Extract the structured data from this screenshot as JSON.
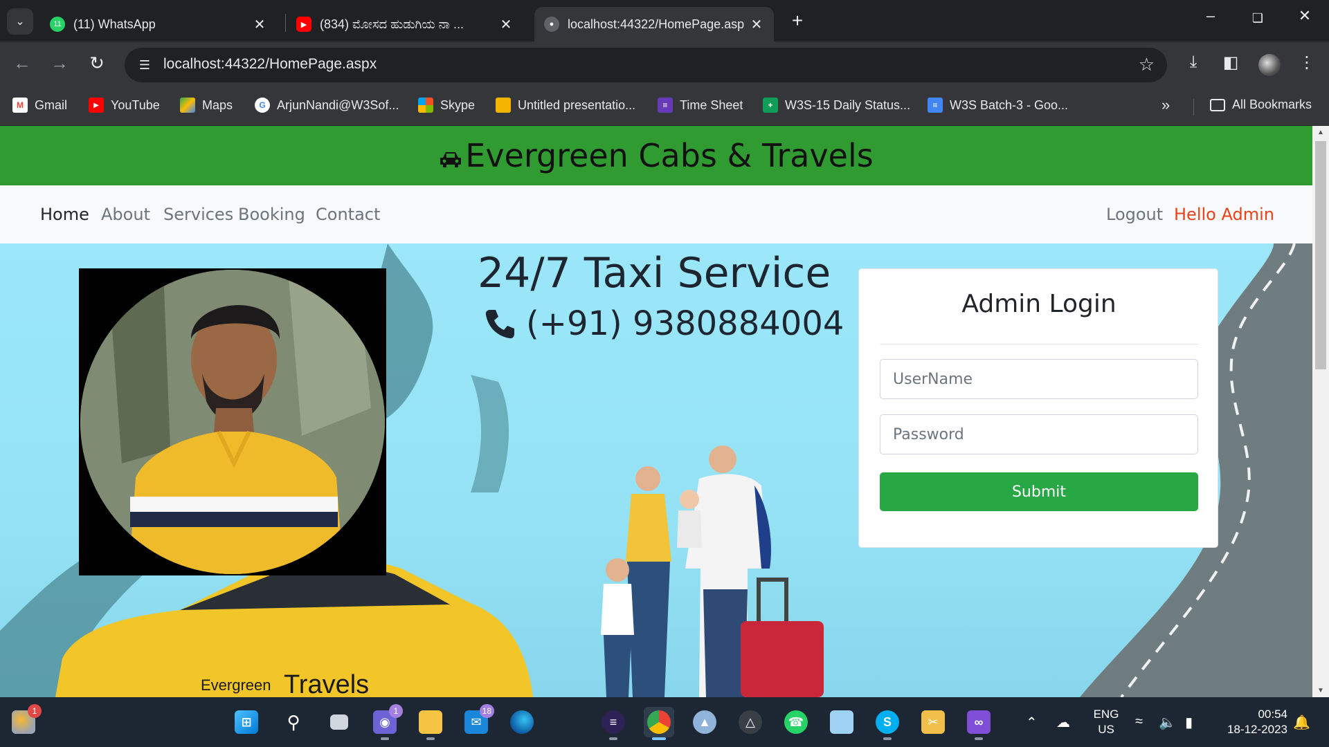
{
  "browser": {
    "tabs": [
      {
        "title": "(11) WhatsApp",
        "favicon": "whatsapp-icon",
        "badge": "11",
        "color": "#25d366"
      },
      {
        "title": "(834) ಮೋಸದ ಹುಡುಗಿಯ ನಾ ...",
        "favicon": "youtube-icon",
        "color": "#ff0000"
      },
      {
        "title": "localhost:44322/HomePage.asp",
        "favicon": "globe-icon",
        "active": true
      }
    ],
    "url": "localhost:44322/HomePage.aspx",
    "bookmarks": [
      {
        "label": "Gmail",
        "icon": "gmail-icon"
      },
      {
        "label": "YouTube",
        "icon": "youtube-icon"
      },
      {
        "label": "Maps",
        "icon": "maps-icon"
      },
      {
        "label": "ArjunNandi@W3Sof...",
        "icon": "google-icon"
      },
      {
        "label": "Skype",
        "icon": "microsoft-icon"
      },
      {
        "label": "Untitled presentatio...",
        "icon": "slides-icon"
      },
      {
        "label": "Time Sheet",
        "icon": "forms-icon"
      },
      {
        "label": "W3S-15 Daily Status...",
        "icon": "sheets-icon"
      },
      {
        "label": "W3S Batch-3 - Goo...",
        "icon": "docs-icon"
      }
    ],
    "bookmarks_overflow": "»",
    "all_bookmarks": "All Bookmarks"
  },
  "site": {
    "brand": "Evergreen Cabs & Travels",
    "nav": {
      "home": "Home",
      "about": "About",
      "services": "Services",
      "booking": "Booking",
      "contact": "Contact",
      "logout": "Logout",
      "hello": "Hello Admin"
    },
    "headline": "24/7 Taxi Service",
    "phone": "(+91) 9380884004",
    "taxi_text_small": "Evergreen",
    "taxi_text_large": "Travels",
    "login": {
      "title": "Admin Login",
      "username_placeholder": "UserName",
      "password_placeholder": "Password",
      "submit": "Submit"
    }
  },
  "taskbar": {
    "weather_badge": "1",
    "teams_badge": "1",
    "mail_badge": "18",
    "lang_line1": "ENG",
    "lang_line2": "US",
    "time": "00:54",
    "date": "18-12-2023"
  },
  "colors": {
    "brand_bar": "#2f9b30",
    "hello_admin": "#e8421a",
    "submit": "#28a745"
  }
}
